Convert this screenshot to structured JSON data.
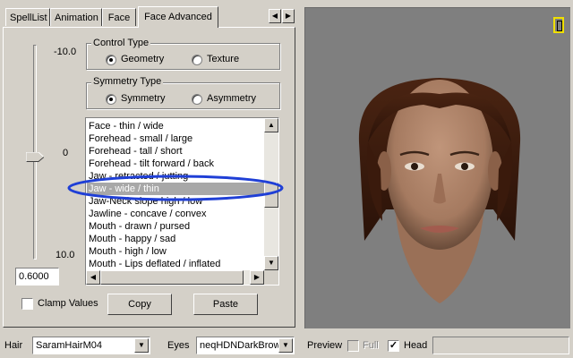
{
  "tabs": [
    {
      "label": "SpellList"
    },
    {
      "label": "Animation"
    },
    {
      "label": "Face"
    },
    {
      "label": "Face Advanced"
    }
  ],
  "slider": {
    "top_label": "-10.0",
    "mid_label": "0",
    "bottom_label": "10.0",
    "value": "0.6000"
  },
  "control_type": {
    "title": "Control Type",
    "options": [
      {
        "label": "Geometry",
        "selected": true
      },
      {
        "label": "Texture",
        "selected": false
      }
    ]
  },
  "symmetry_type": {
    "title": "Symmetry Type",
    "options": [
      {
        "label": "Symmetry",
        "selected": true
      },
      {
        "label": "Asymmetry",
        "selected": false
      }
    ]
  },
  "morph_list": {
    "items": [
      "Face - thin / wide",
      "Forehead - small / large",
      "Forehead - tall / short",
      "Forehead - tilt forward / back",
      "Jaw - retracted / jutting",
      "Jaw - wide / thin",
      "Jaw-Neck slope high / low",
      "Jawline - concave / convex",
      "Mouth - drawn / pursed",
      "Mouth - happy / sad",
      "Mouth - high / low",
      "Mouth - Lips deflated / inflated"
    ],
    "selected_index": 5,
    "highlight_color": "#1f3fd6"
  },
  "clamp_values": {
    "label": "Clamp Values",
    "checked": false
  },
  "buttons": {
    "copy": "Copy",
    "paste": "Paste"
  },
  "bottom_bar": {
    "hair_label": "Hair",
    "hair_value": "SaramHairM04",
    "eyes_label": "Eyes",
    "eyes_value": "neqHDNDarkBrow",
    "preview_label": "Preview",
    "full_label": "Full",
    "full_checked": false,
    "head_label": "Head",
    "head_checked": true
  },
  "viewport": {
    "indicator_color": "#f0e000"
  }
}
